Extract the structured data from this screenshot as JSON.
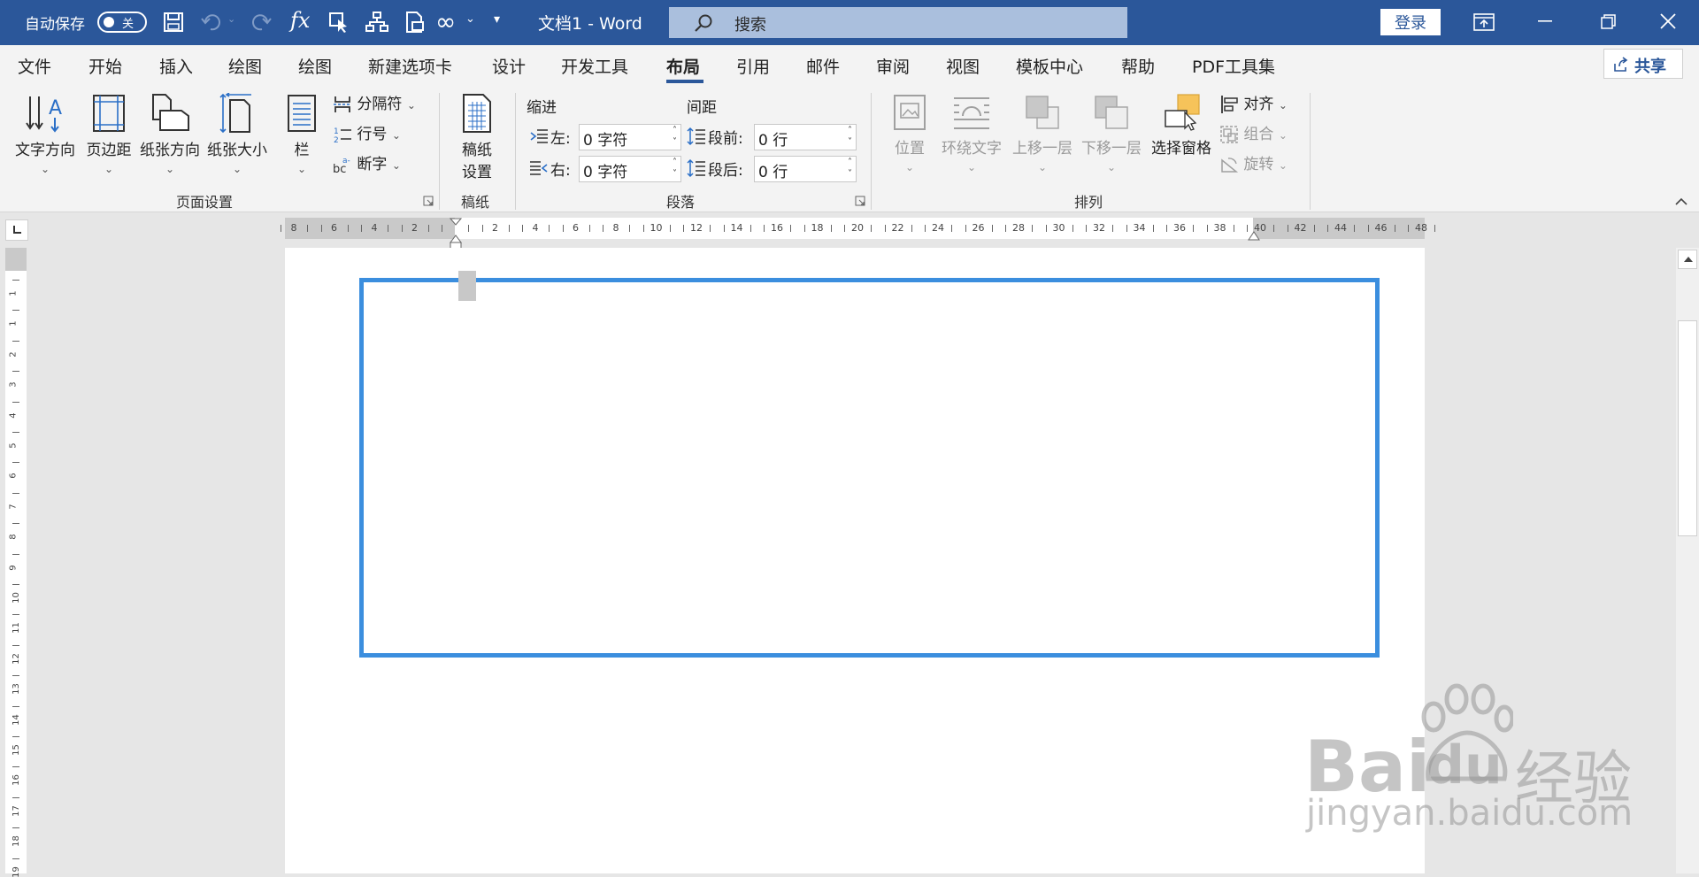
{
  "titlebar": {
    "autosave_label": "自动保存",
    "autosave_state": "关",
    "doc_title": "文档1  -  Word",
    "search_placeholder": "搜索",
    "login_label": "登录"
  },
  "menu": {
    "items": [
      "文件",
      "开始",
      "插入",
      "绘图",
      "绘图",
      "新建选项卡",
      "设计",
      "开发工具",
      "布局",
      "引用",
      "邮件",
      "审阅",
      "视图",
      "模板中心",
      "帮助",
      "PDF工具集"
    ],
    "active": "布局",
    "share_label": "共享"
  },
  "ribbon": {
    "page_setup": {
      "text_direction": "文字方向",
      "margins": "页边距",
      "orientation": "纸张方向",
      "size": "纸张大小",
      "columns": "栏",
      "breaks": "分隔符",
      "line_numbers": "行号",
      "hyphenation": "断字",
      "group_label": "页面设置"
    },
    "manuscript": {
      "setup_line1": "稿纸",
      "setup_line2": "设置",
      "group_label": "稿纸"
    },
    "paragraph": {
      "indent_label": "缩进",
      "spacing_label": "间距",
      "left_label": "左:",
      "left_value": "0 字符",
      "right_label": "右:",
      "right_value": "0 字符",
      "before_label": "段前:",
      "before_value": "0 行",
      "after_label": "段后:",
      "after_value": "0 行",
      "group_label": "段落"
    },
    "arrange": {
      "position": "位置",
      "wrap_text": "环绕文字",
      "bring_forward": "上移一层",
      "send_backward": "下移一层",
      "selection_pane": "选择窗格",
      "align": "对齐",
      "group": "组合",
      "rotate": "旋转",
      "group_label": "排列"
    }
  },
  "ruler": {
    "horizontal_ticks": [
      "8",
      "6",
      "4",
      "2",
      "",
      "2",
      "4",
      "6",
      "8",
      "10",
      "12",
      "14",
      "16",
      "18",
      "20",
      "22",
      "24",
      "26",
      "28",
      "30",
      "32",
      "34",
      "36",
      "38",
      "40",
      "42",
      "44",
      "46",
      "48"
    ],
    "vertical_ticks": [
      "1",
      "1",
      "2",
      "3",
      "4",
      "5",
      "6",
      "7",
      "8",
      "9",
      "10",
      "11",
      "12",
      "13",
      "14",
      "15",
      "16",
      "17",
      "18",
      "19"
    ]
  },
  "watermark": {
    "brand": "Bai",
    "brand2": "du",
    "cn": "经验",
    "url": "jingyan.baidu.com"
  },
  "colors": {
    "titlebar": "#2b579a",
    "textbox_border": "#3b8ede",
    "ribbon_bg": "#f3f3f3"
  }
}
